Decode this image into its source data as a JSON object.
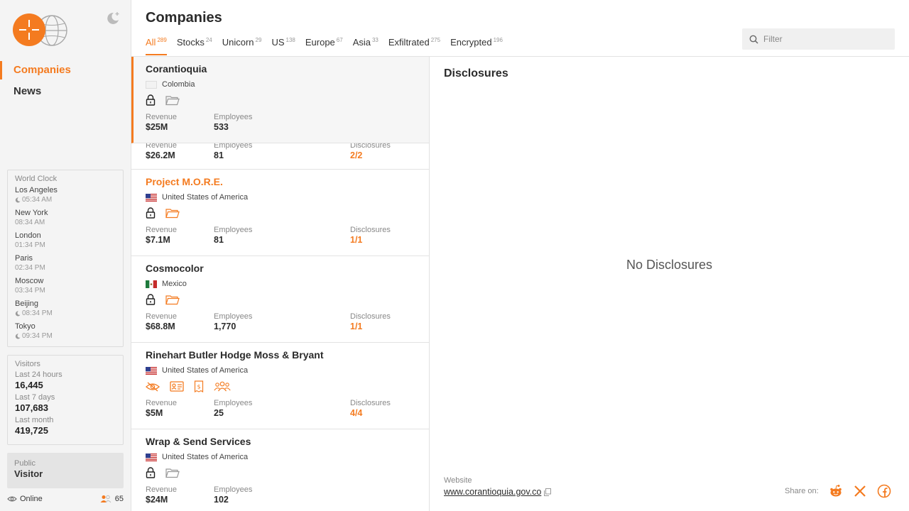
{
  "sidebar": {
    "nav": [
      {
        "label": "Companies",
        "active": true
      },
      {
        "label": "News",
        "active": false
      }
    ],
    "world_clock": {
      "title": "World Clock",
      "cities": [
        {
          "city": "Los Angeles",
          "time": "05:34 AM",
          "night": true
        },
        {
          "city": "New York",
          "time": "08:34 AM",
          "night": false
        },
        {
          "city": "London",
          "time": "01:34 PM",
          "night": false
        },
        {
          "city": "Paris",
          "time": "02:34 PM",
          "night": false
        },
        {
          "city": "Moscow",
          "time": "03:34 PM",
          "night": false
        },
        {
          "city": "Beijing",
          "time": "08:34 PM",
          "night": true
        },
        {
          "city": "Tokyo",
          "time": "09:34 PM",
          "night": true
        }
      ]
    },
    "visitors": {
      "title": "Visitors",
      "stats": [
        {
          "label": "Last 24 hours",
          "value": "16,445"
        },
        {
          "label": "Last 7 days",
          "value": "107,683"
        },
        {
          "label": "Last month",
          "value": "419,725"
        }
      ]
    },
    "user": {
      "role": "Public",
      "name": "Visitor"
    },
    "status": {
      "label": "Online",
      "count": "65"
    }
  },
  "header": {
    "title": "Companies",
    "tabs": [
      {
        "label": "All",
        "count": "289",
        "active": true
      },
      {
        "label": "Stocks",
        "count": "24"
      },
      {
        "label": "Unicorn",
        "count": "29"
      },
      {
        "label": "US",
        "count": "138"
      },
      {
        "label": "Europe",
        "count": "67"
      },
      {
        "label": "Asia",
        "count": "33"
      },
      {
        "label": "Exfiltrated",
        "count": "275"
      },
      {
        "label": "Encrypted",
        "count": "196"
      }
    ],
    "filter_placeholder": "Filter"
  },
  "companies": [
    {
      "name": "Corantioquia",
      "country": "Colombia",
      "flag": "blank",
      "icons": [
        "lock-icon",
        "folder-icon"
      ],
      "icon_active": false,
      "revenue": "$25M",
      "employees": "533",
      "disclosures": null,
      "selected": true
    },
    {
      "name": "",
      "country": "",
      "revenue": "$26.2M",
      "employees": "81",
      "disclosures": "2/2",
      "partial": true
    },
    {
      "name": "Project M.O.R.E.",
      "country": "United States of America",
      "flag": "us",
      "icons": [
        "lock-icon",
        "folder-icon"
      ],
      "icon_active": true,
      "name_orange": true,
      "revenue": "$7.1M",
      "employees": "81",
      "disclosures": "1/1"
    },
    {
      "name": "Cosmocolor",
      "country": "Mexico",
      "flag": "mx",
      "icons": [
        "lock-icon",
        "folder-icon"
      ],
      "icon_active": true,
      "revenue": "$68.8M",
      "employees": "1,770",
      "disclosures": "1/1"
    },
    {
      "name": "Rinehart Butler Hodge Moss & Bryant",
      "country": "United States of America",
      "flag": "us",
      "icons": [
        "eye-slash-icon",
        "id-card-icon",
        "money-receipt-icon",
        "people-icon"
      ],
      "icon_active": true,
      "revenue": "$5M",
      "employees": "25",
      "disclosures": "4/4"
    },
    {
      "name": "Wrap & Send Services",
      "country": "United States of America",
      "flag": "us",
      "icons": [
        "lock-icon",
        "folder-icon"
      ],
      "icon_active": false,
      "revenue": "$24M",
      "employees": "102",
      "disclosures": null
    }
  ],
  "labels": {
    "revenue": "Revenue",
    "employees": "Employees",
    "disclosures": "Disclosures"
  },
  "detail": {
    "title": "Disclosures",
    "empty": "No Disclosures",
    "website_label": "Website",
    "website": "www.corantioquia.gov.co",
    "share_label": "Share on:"
  },
  "colors": {
    "accent": "#f47b20",
    "sidebar_bg": "#f4f4f4",
    "border": "#e2e2e2"
  }
}
